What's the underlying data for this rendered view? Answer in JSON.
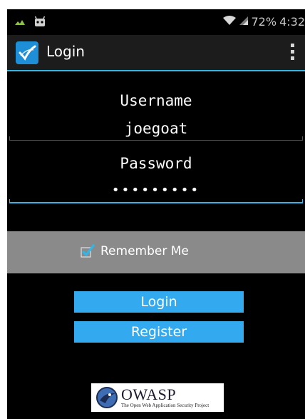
{
  "status_bar": {
    "battery": "72%",
    "time": "4:32"
  },
  "action_bar": {
    "title": "Login"
  },
  "form": {
    "username_label": "Username",
    "username_value": "joegoat",
    "password_label": "Password",
    "password_value": "•••••••••"
  },
  "remember": {
    "label": "Remember Me",
    "checked": true
  },
  "buttons": {
    "login_label": "Login",
    "register_label": "Register"
  },
  "logo": {
    "name": "OWASP",
    "tagline": "The Open Web Application Security Project"
  },
  "colors": {
    "accent": "#33b5e5",
    "button": "#33a9f0",
    "band": "#8a8a8a",
    "background": "#000000"
  },
  "icons": [
    "notification-icon",
    "android-icon",
    "wifi-icon",
    "signal-icon",
    "app-check-icon",
    "overflow-menu-icon",
    "checkbox-icon",
    "owasp-logo-icon"
  ]
}
